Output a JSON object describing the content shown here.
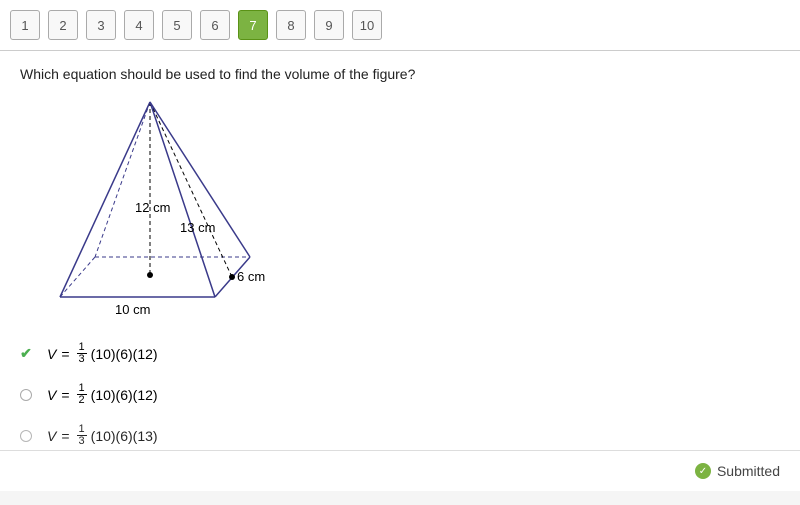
{
  "nav": {
    "items": [
      "1",
      "2",
      "3",
      "4",
      "5",
      "6",
      "7",
      "8",
      "9",
      "10"
    ],
    "active": "7"
  },
  "question": "Which equation should be used to find the volume of the figure?",
  "figure": {
    "height_label": "12 cm",
    "slant_label": "13 cm",
    "side_label": "6 cm",
    "base_label": "10 cm"
  },
  "options": [
    {
      "v": "V",
      "eq": "=",
      "num": "1",
      "den": "3",
      "rest": "(10)(6)(12)",
      "state": "correct"
    },
    {
      "v": "V",
      "eq": "=",
      "num": "1",
      "den": "2",
      "rest": "(10)(6)(12)",
      "state": "unselected"
    },
    {
      "v": "V",
      "eq": "=",
      "num": "1",
      "den": "3",
      "rest": "(10)(6)(13)",
      "state": "unselected"
    }
  ],
  "footer": {
    "status": "Submitted"
  }
}
